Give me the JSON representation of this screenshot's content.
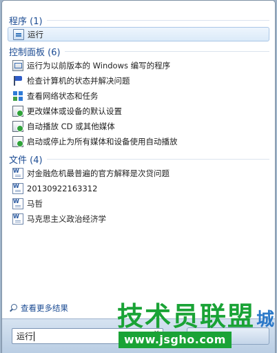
{
  "groups": [
    {
      "title": "程序 (1)",
      "items": [
        {
          "label": "运行",
          "icon": "run-icon"
        }
      ]
    },
    {
      "title": "控制面板 (6)",
      "items": [
        {
          "label": "运行为以前版本的 Windows 编写的程序",
          "icon": "compatibility-icon"
        },
        {
          "label": "检查计算机的状态并解决问题",
          "icon": "action-center-flag-icon"
        },
        {
          "label": "查看网络状态和任务",
          "icon": "network-icon"
        },
        {
          "label": "更改媒体或设备的默认设置",
          "icon": "autoplay-icon"
        },
        {
          "label": "自动播放 CD 或其他媒体",
          "icon": "autoplay-icon"
        },
        {
          "label": "启动或停止为所有媒体和设备使用自动播放",
          "icon": "autoplay-icon"
        }
      ]
    },
    {
      "title": "文件 (4)",
      "items": [
        {
          "label": "对金融危机最普遍的官方解释是次贷问题",
          "icon": "word-document-icon"
        },
        {
          "label": "20130922163312",
          "icon": "word-document-icon"
        },
        {
          "label": "马哲",
          "icon": "word-document-icon"
        },
        {
          "label": "马克思主义政治经济学",
          "icon": "word-document-icon"
        }
      ]
    }
  ],
  "see_more": "查看更多结果",
  "search": {
    "value": "运行"
  },
  "watermark": {
    "text": "技术员联盟",
    "suffix": "城",
    "url": "www.jsgho.com"
  },
  "colors": {
    "group_header": "#1b4b93",
    "selection_border": "#a9c6e6",
    "watermark_green": "#1aa336"
  }
}
